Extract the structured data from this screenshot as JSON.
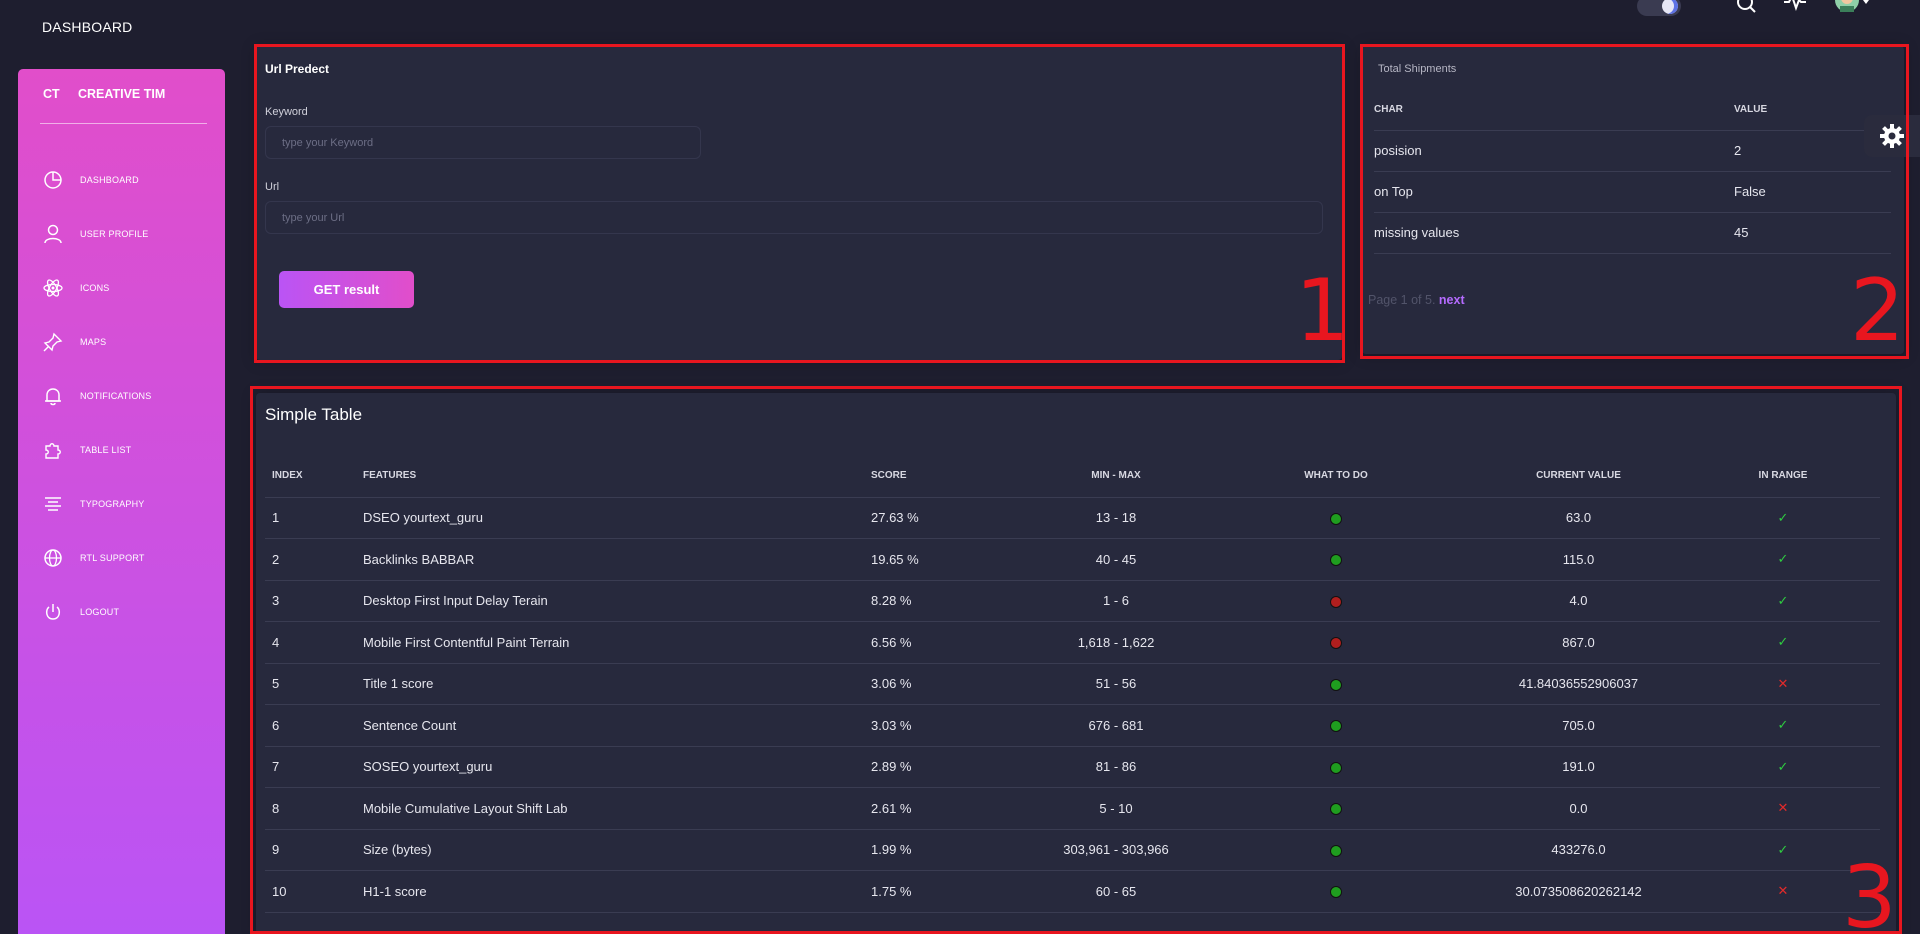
{
  "navbar": {
    "title": "DASHBOARD",
    "icons": [
      "theme-toggle",
      "search-icon",
      "activity-icon",
      "avatar"
    ]
  },
  "sidebar": {
    "logo_mini": "CT",
    "logo_text": "CREATIVE TIM",
    "items": [
      {
        "label": "DASHBOARD",
        "icon": "chart-pie-icon"
      },
      {
        "label": "USER PROFILE",
        "icon": "user-icon"
      },
      {
        "label": "ICONS",
        "icon": "atom-icon"
      },
      {
        "label": "MAPS",
        "icon": "pin-icon"
      },
      {
        "label": "NOTIFICATIONS",
        "icon": "bell-icon"
      },
      {
        "label": "TABLE LIST",
        "icon": "puzzle-icon"
      },
      {
        "label": "TYPOGRAPHY",
        "icon": "align-center-icon"
      },
      {
        "label": "RTL SUPPORT",
        "icon": "world-icon"
      },
      {
        "label": "LOGOUT",
        "icon": "power-icon"
      }
    ],
    "gradient": [
      "#e14eca",
      "#ba54f5"
    ]
  },
  "url_predict": {
    "title": "Url Predect",
    "keyword_label": "Keyword",
    "keyword_placeholder": "type your Keyword",
    "url_label": "Url",
    "url_placeholder": "type your Url",
    "button_label": "GET result"
  },
  "shipments": {
    "title": "Total Shipments",
    "headers": [
      "CHAR",
      "VALUE"
    ],
    "rows": [
      [
        "posision",
        "2"
      ],
      [
        "on Top",
        "False"
      ],
      [
        "missing values",
        "45"
      ]
    ],
    "pager_text": "Page 1 of 5.",
    "next_label": "next"
  },
  "simple_table": {
    "title": "Simple Table",
    "headers": [
      "INDEX",
      "FEATURES",
      "SCORE",
      "MIN - MAX",
      "WHAT TO DO",
      "CURRENT VALUE",
      "IN RANGE"
    ],
    "rows": [
      {
        "index": "1",
        "feature": "DSEO yourtext_guru",
        "score": "27.63 %",
        "range": "13 - 18",
        "status": "green",
        "value": "63.0",
        "in_range": true
      },
      {
        "index": "2",
        "feature": "Backlinks BABBAR",
        "score": "19.65 %",
        "range": "40 - 45",
        "status": "green",
        "value": "115.0",
        "in_range": true
      },
      {
        "index": "3",
        "feature": "Desktop First Input Delay Terain",
        "score": "8.28 %",
        "range": "1 - 6",
        "status": "red",
        "value": "4.0",
        "in_range": true
      },
      {
        "index": "4",
        "feature": "Mobile First Contentful Paint Terrain",
        "score": "6.56 %",
        "range": "1,618 - 1,622",
        "status": "red",
        "value": "867.0",
        "in_range": true
      },
      {
        "index": "5",
        "feature": "Title 1 score",
        "score": "3.06 %",
        "range": "51 - 56",
        "status": "green",
        "value": "41.84036552906037",
        "in_range": false
      },
      {
        "index": "6",
        "feature": "Sentence Count",
        "score": "3.03 %",
        "range": "676 - 681",
        "status": "green",
        "value": "705.0",
        "in_range": true
      },
      {
        "index": "7",
        "feature": "SOSEO yourtext_guru",
        "score": "2.89 %",
        "range": "81 - 86",
        "status": "green",
        "value": "191.0",
        "in_range": true
      },
      {
        "index": "8",
        "feature": "Mobile Cumulative Layout Shift Lab",
        "score": "2.61 %",
        "range": "5 - 10",
        "status": "green",
        "value": "0.0",
        "in_range": false
      },
      {
        "index": "9",
        "feature": "Size (bytes)",
        "score": "1.99 %",
        "range": "303,961 - 303,966",
        "status": "green",
        "value": "433276.0",
        "in_range": true
      },
      {
        "index": "10",
        "feature": "H1-1 score",
        "score": "1.75 %",
        "range": "60 - 65",
        "status": "green",
        "value": "30.073508620262142",
        "in_range": false
      }
    ]
  },
  "annotations": [
    "1",
    "2",
    "3"
  ],
  "colors": {
    "background": "#1e1e2f",
    "card": "#27293d",
    "status_green": "#1f9d1f",
    "status_red": "#b01e1e",
    "check": "#2ecc40",
    "cross": "#e22a2a",
    "annotation": "#e8161f",
    "link": "#b56bff"
  }
}
